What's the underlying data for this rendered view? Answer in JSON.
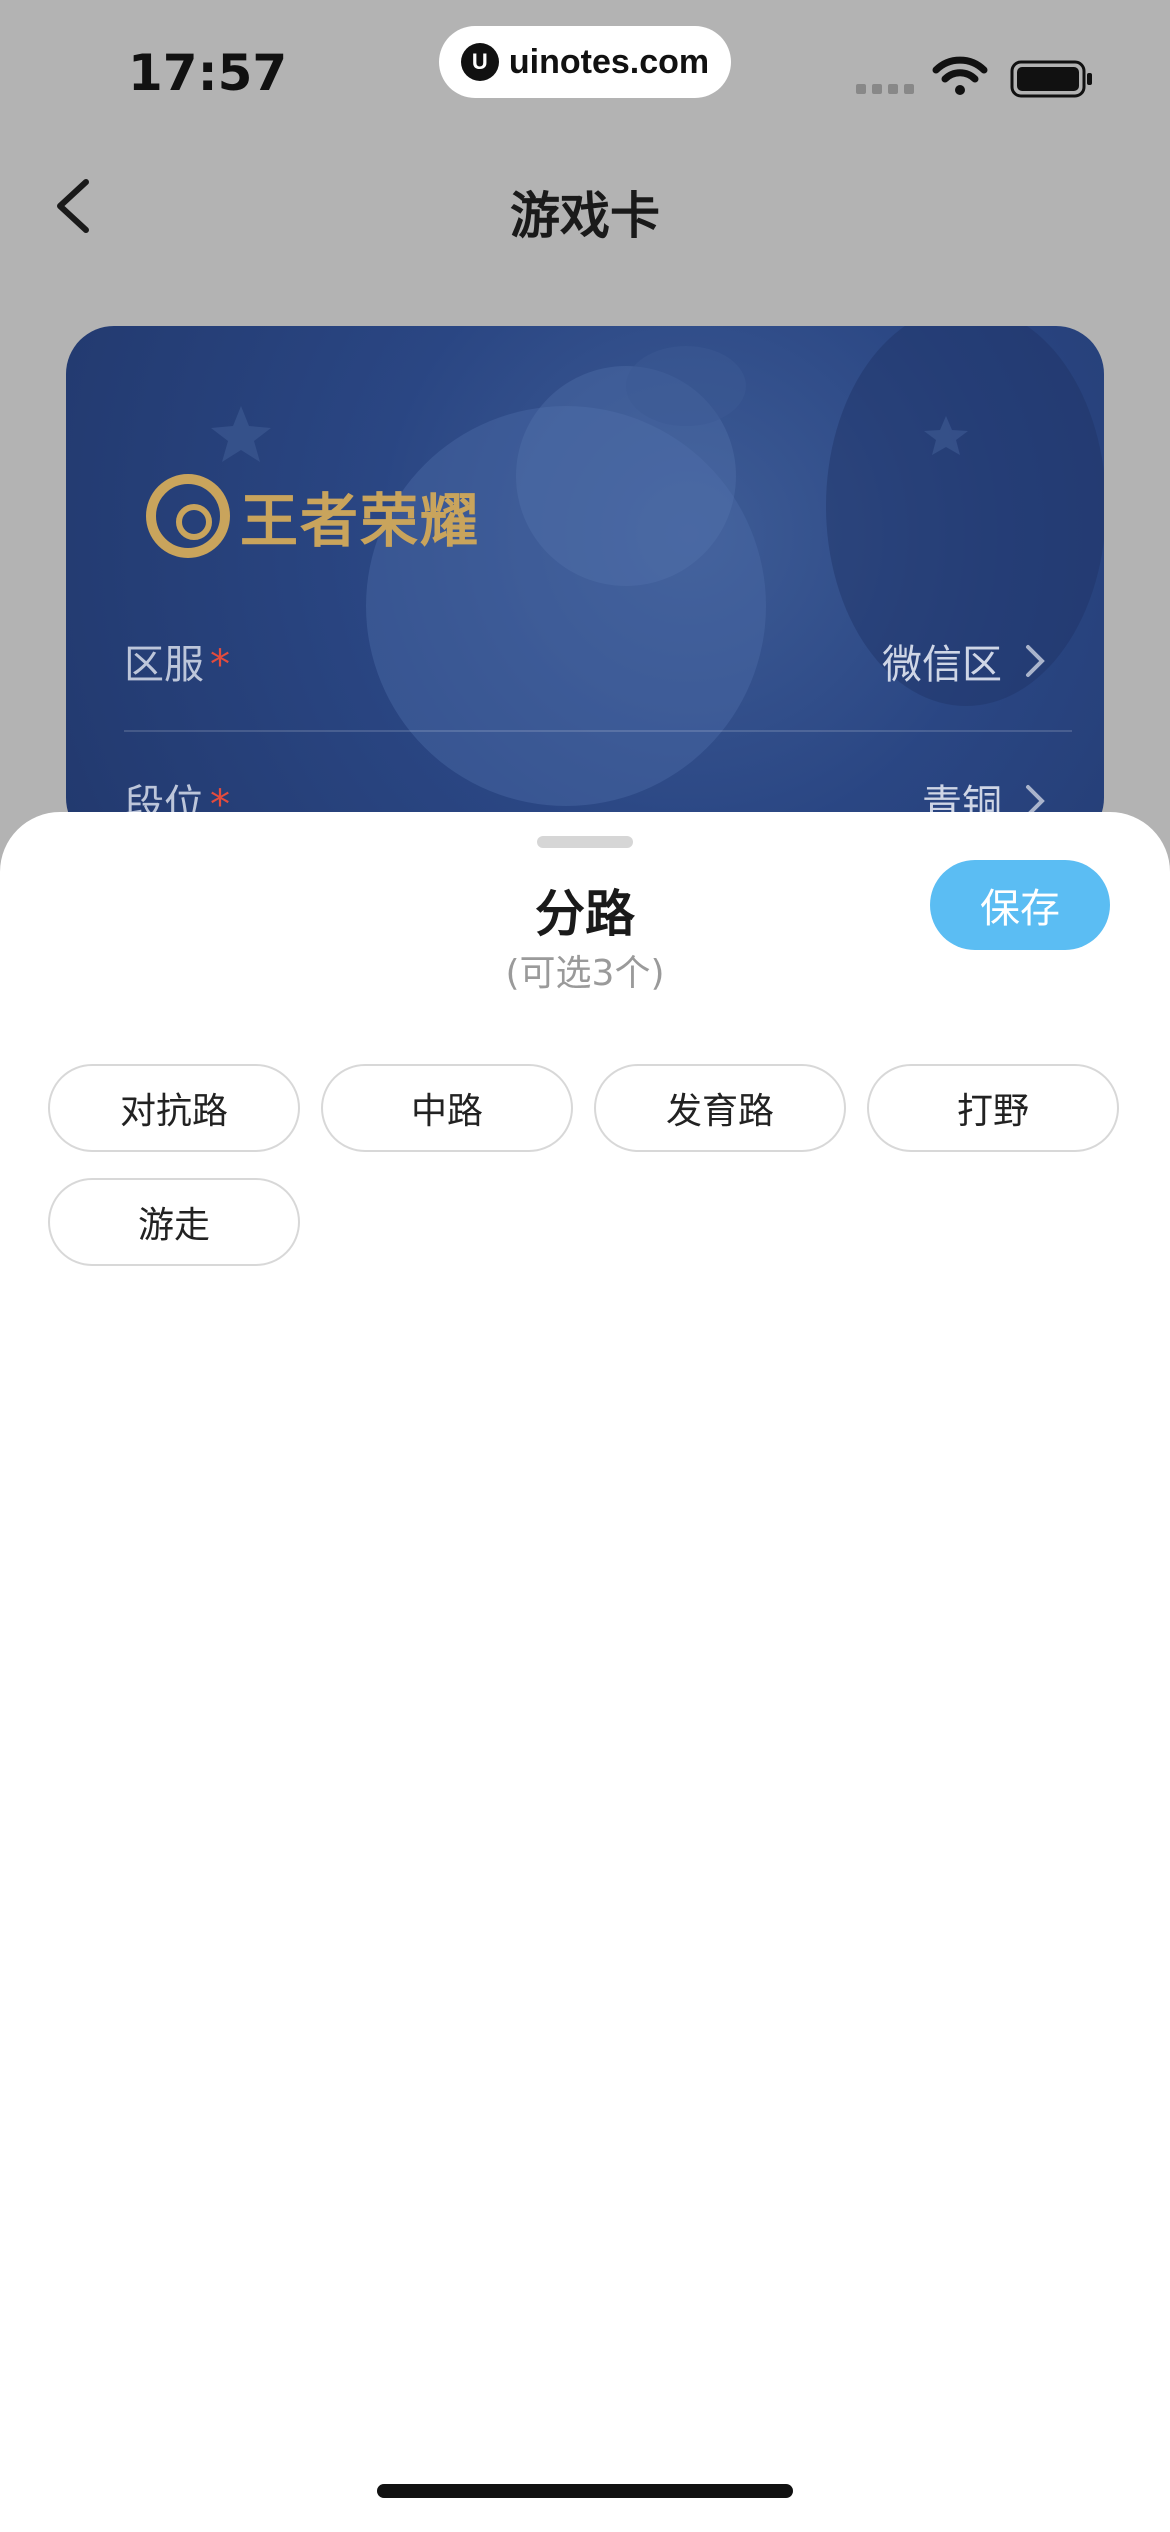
{
  "status_bar": {
    "time": "17:57",
    "url": "uinotes.com",
    "url_logo": "U"
  },
  "nav": {
    "title": "游戏卡",
    "back_icon": "chevron-left-icon"
  },
  "card": {
    "game_name": "王者荣耀",
    "rows": [
      {
        "label": "区服",
        "required_mark": "*",
        "value": "微信区"
      },
      {
        "label": "段位",
        "required_mark": "*",
        "value": "青铜"
      }
    ]
  },
  "sheet": {
    "title": "分路",
    "subtitle": "(可选3个)",
    "save_label": "保存",
    "options": [
      "对抗路",
      "中路",
      "发育路",
      "打野",
      "游走"
    ]
  },
  "colors": {
    "accent": "#5bbdf3",
    "required": "#e44b3c",
    "card_bg": "#2a4683",
    "logo_gold": "#c9a45c"
  }
}
